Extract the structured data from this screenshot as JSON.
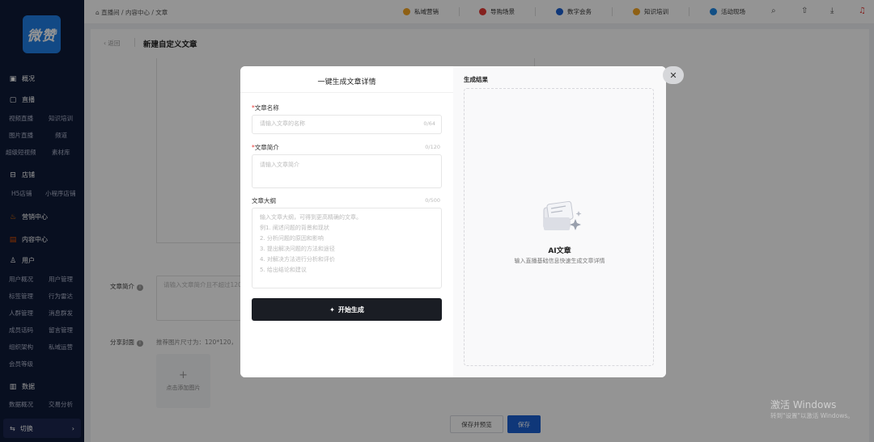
{
  "sidebar": {
    "logo": "微赞",
    "sections": [
      {
        "icon": "overview-icon",
        "label": "概况"
      },
      {
        "icon": "live-icon",
        "label": "直播"
      },
      {
        "icon": "store-icon",
        "label": "店铺"
      },
      {
        "icon": "fire-icon",
        "label": "营销中心"
      },
      {
        "icon": "content-icon",
        "label": "内容中心"
      },
      {
        "icon": "user-icon",
        "label": "用户"
      },
      {
        "icon": "data-icon",
        "label": "数据"
      }
    ],
    "live_items": [
      "视频直播",
      "知识培训",
      "图片直播",
      "频道",
      "超级短视频",
      "素材库"
    ],
    "store_items": [
      "H5店铺",
      "小程序店铺"
    ],
    "user_items": [
      "用户概况",
      "用户管理",
      "标签管理",
      "行为雷达",
      "人群管理",
      "消息群发",
      "成员话码",
      "留言管理",
      "组织架构",
      "私域运营",
      "会员等级"
    ],
    "data_items": [
      "数据概况",
      "交易分析"
    ],
    "switch_label": "切换",
    "switch_arrow": "›"
  },
  "topbar": {
    "home_icon": "⌂",
    "breadcrumb": "直播间  /  内容中心 / 文章",
    "nav": [
      {
        "icon": "private-domain-icon",
        "label": "私域营销",
        "color": "#f5a623"
      },
      {
        "icon": "shopping-icon",
        "label": "导购场景",
        "color": "#e53935"
      },
      {
        "icon": "digital-conference-icon",
        "label": "数字会务",
        "color": "#1a5fd1"
      },
      {
        "icon": "knowledge-icon",
        "label": "知识培训",
        "color": "#f5a623"
      },
      {
        "icon": "location-icon",
        "label": "活动现场",
        "color": "#1e88e5"
      }
    ],
    "search_icon": "⌕",
    "upload_icon": "⇧",
    "download_icon": "⤓",
    "bell_icon": "♫"
  },
  "page": {
    "back_label": "‹  返回",
    "title": "新建自定义文章",
    "desc_label": "文章简介",
    "desc_placeholder": "请输入文章简介且不超过120",
    "cover_label": "分享封面",
    "cover_hint": "推荐图片尺寸为：120*120，",
    "info_icon": "i",
    "upload_plus": "+",
    "upload_label": "点击添加图片",
    "save_preview_label": "保存并预览",
    "save_label": "保存"
  },
  "modal": {
    "title": "一键生成文章详情",
    "name_label": "文章名称",
    "required_mark": "*",
    "name_placeholder": "请输入文章的名称",
    "name_count": "0/64",
    "intro_label": "文章简介",
    "intro_placeholder": "请输入文章简介",
    "intro_count": "0/120",
    "outline_label": "文章大纲",
    "outline_count": "0/500",
    "outline_placeholder_lines": [
      "输入文章大纲，可得到更高精确的文章。",
      "例1. 阐述问题的背景和现状",
      "2. 分析问题的原因和影响",
      "3. 提出解决问题的方法和途径",
      "4. 对解决方法进行分析和评价",
      "5. 给出结论和建议"
    ],
    "generate_label": "开始生成",
    "generate_icon": "✦",
    "result_title": "生成结果",
    "ai_title": "AI文章",
    "ai_subtitle": "输入直播基础信息快速生成文章详情",
    "close_icon": "✕"
  },
  "watermark": {
    "line1": "激活 Windows",
    "line2": "转到\"设置\"以激活 Windows。"
  }
}
